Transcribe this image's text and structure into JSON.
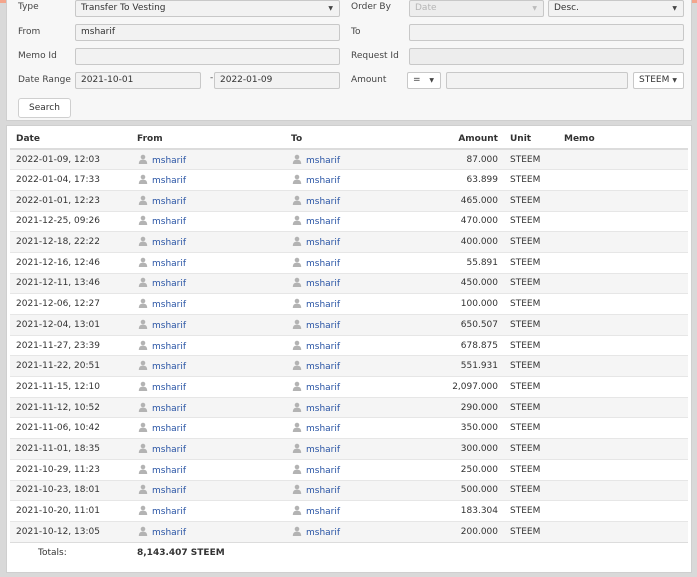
{
  "filters": {
    "type_label": "Type",
    "type_value": "Transfer To Vesting",
    "order_by_label": "Order By",
    "order_by_value": "Date",
    "order_dir_value": "Desc.",
    "from_label": "From",
    "from_value": "msharif",
    "to_label": "To",
    "to_value": "",
    "memo_id_label": "Memo Id",
    "memo_id_value": "",
    "request_id_label": "Request Id",
    "request_id_value": "",
    "date_range_label": "Date Range",
    "date_from": "2021-10-01",
    "date_separator": "-",
    "date_to": "2022-01-09",
    "amount_label": "Amount",
    "amount_operator": "=",
    "amount_value": "",
    "currency_value": "STEEM",
    "search_label": "Search"
  },
  "table": {
    "headers": {
      "date": "Date",
      "from": "From",
      "to": "To",
      "amount": "Amount",
      "unit": "Unit",
      "memo": "Memo"
    },
    "rows": [
      {
        "date": "2022-01-09, 12:03",
        "from": "msharif",
        "to": "msharif",
        "amount": "87.000",
        "unit": "STEEM",
        "memo": ""
      },
      {
        "date": "2022-01-04, 17:33",
        "from": "msharif",
        "to": "msharif",
        "amount": "63.899",
        "unit": "STEEM",
        "memo": ""
      },
      {
        "date": "2022-01-01, 12:23",
        "from": "msharif",
        "to": "msharif",
        "amount": "465.000",
        "unit": "STEEM",
        "memo": ""
      },
      {
        "date": "2021-12-25, 09:26",
        "from": "msharif",
        "to": "msharif",
        "amount": "470.000",
        "unit": "STEEM",
        "memo": ""
      },
      {
        "date": "2021-12-18, 22:22",
        "from": "msharif",
        "to": "msharif",
        "amount": "400.000",
        "unit": "STEEM",
        "memo": ""
      },
      {
        "date": "2021-12-16, 12:46",
        "from": "msharif",
        "to": "msharif",
        "amount": "55.891",
        "unit": "STEEM",
        "memo": ""
      },
      {
        "date": "2021-12-11, 13:46",
        "from": "msharif",
        "to": "msharif",
        "amount": "450.000",
        "unit": "STEEM",
        "memo": ""
      },
      {
        "date": "2021-12-06, 12:27",
        "from": "msharif",
        "to": "msharif",
        "amount": "100.000",
        "unit": "STEEM",
        "memo": ""
      },
      {
        "date": "2021-12-04, 13:01",
        "from": "msharif",
        "to": "msharif",
        "amount": "650.507",
        "unit": "STEEM",
        "memo": ""
      },
      {
        "date": "2021-11-27, 23:39",
        "from": "msharif",
        "to": "msharif",
        "amount": "678.875",
        "unit": "STEEM",
        "memo": ""
      },
      {
        "date": "2021-11-22, 20:51",
        "from": "msharif",
        "to": "msharif",
        "amount": "551.931",
        "unit": "STEEM",
        "memo": ""
      },
      {
        "date": "2021-11-15, 12:10",
        "from": "msharif",
        "to": "msharif",
        "amount": "2,097.000",
        "unit": "STEEM",
        "memo": ""
      },
      {
        "date": "2021-11-12, 10:52",
        "from": "msharif",
        "to": "msharif",
        "amount": "290.000",
        "unit": "STEEM",
        "memo": ""
      },
      {
        "date": "2021-11-06, 10:42",
        "from": "msharif",
        "to": "msharif",
        "amount": "350.000",
        "unit": "STEEM",
        "memo": ""
      },
      {
        "date": "2021-11-01, 18:35",
        "from": "msharif",
        "to": "msharif",
        "amount": "300.000",
        "unit": "STEEM",
        "memo": ""
      },
      {
        "date": "2021-10-29, 11:23",
        "from": "msharif",
        "to": "msharif",
        "amount": "250.000",
        "unit": "STEEM",
        "memo": ""
      },
      {
        "date": "2021-10-23, 18:01",
        "from": "msharif",
        "to": "msharif",
        "amount": "500.000",
        "unit": "STEEM",
        "memo": ""
      },
      {
        "date": "2021-10-20, 11:01",
        "from": "msharif",
        "to": "msharif",
        "amount": "183.304",
        "unit": "STEEM",
        "memo": ""
      },
      {
        "date": "2021-10-12, 13:05",
        "from": "msharif",
        "to": "msharif",
        "amount": "200.000",
        "unit": "STEEM",
        "memo": ""
      }
    ],
    "totals_label": "Totals:",
    "totals_value": "8,143.407 STEEM"
  },
  "icons": {
    "user": "user-icon",
    "dropdown": "chevron-down-icon"
  },
  "colors": {
    "link": "#2a55a5",
    "accent_line": "#f4a58c",
    "stripe": "#f5f5f5"
  }
}
